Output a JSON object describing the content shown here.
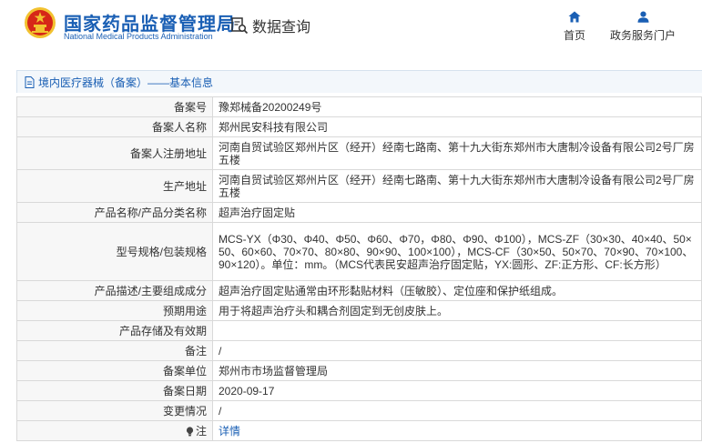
{
  "header": {
    "site_name": "国家药品监督管理局",
    "site_name_en": "National Medical Products Administration",
    "query_label": "数据查询",
    "nav": [
      {
        "label": "首页",
        "icon": "home-icon"
      },
      {
        "label": "政务服务门户",
        "icon": "user-icon"
      }
    ]
  },
  "section": {
    "title": "境内医疗器械（备案）——基本信息",
    "icon": "document-icon"
  },
  "rows": [
    {
      "key": "备案号",
      "value": "豫郑械备20200249号"
    },
    {
      "key": "备案人名称",
      "value": "郑州民安科技有限公司"
    },
    {
      "key": "备案人注册地址",
      "value": "河南自贸试验区郑州片区（经开）经南七路南、第十九大街东郑州市大唐制冷设备有限公司2号厂房五楼"
    },
    {
      "key": "生产地址",
      "value": "河南自贸试验区郑州片区（经开）经南七路南、第十九大街东郑州市大唐制冷设备有限公司2号厂房五楼"
    },
    {
      "key": "产品名称/产品分类名称",
      "value": "超声治疗固定贴"
    },
    {
      "key": "型号规格/包装规格",
      "value": "MCS-YX（Φ30、Φ40、Φ50、Φ60、Φ70，Φ80、Φ90、Φ100），MCS-ZF（30×30、40×40、50×50、60×60、70×70、80×80、90×90、100×100），MCS-CF（30×50、50×70、70×90、70×100、90×120）。单位：mm。（MCS代表民安超声治疗固定贴，YX:圆形、ZF:正方形、CF:长方形）"
    },
    {
      "key": "产品描述/主要组成成分",
      "value": "超声治疗固定贴通常由环形黏贴材料（压敏胶）、定位座和保护纸组成。"
    },
    {
      "key": "预期用途",
      "value": "用于将超声治疗头和耦合剂固定到无创皮肤上。"
    },
    {
      "key": "产品存储及有效期",
      "value": ""
    },
    {
      "key": "备注",
      "value": "/"
    },
    {
      "key": "备案单位",
      "value": "郑州市市场监督管理局"
    },
    {
      "key": "备案日期",
      "value": "2020-09-17"
    },
    {
      "key": "变更情况",
      "value": "/"
    },
    {
      "key": "注",
      "value": "详情"
    }
  ],
  "colors": {
    "brand_blue": "#1a5fb4",
    "logo_red": "#d62718",
    "logo_gold": "#f2c230"
  }
}
